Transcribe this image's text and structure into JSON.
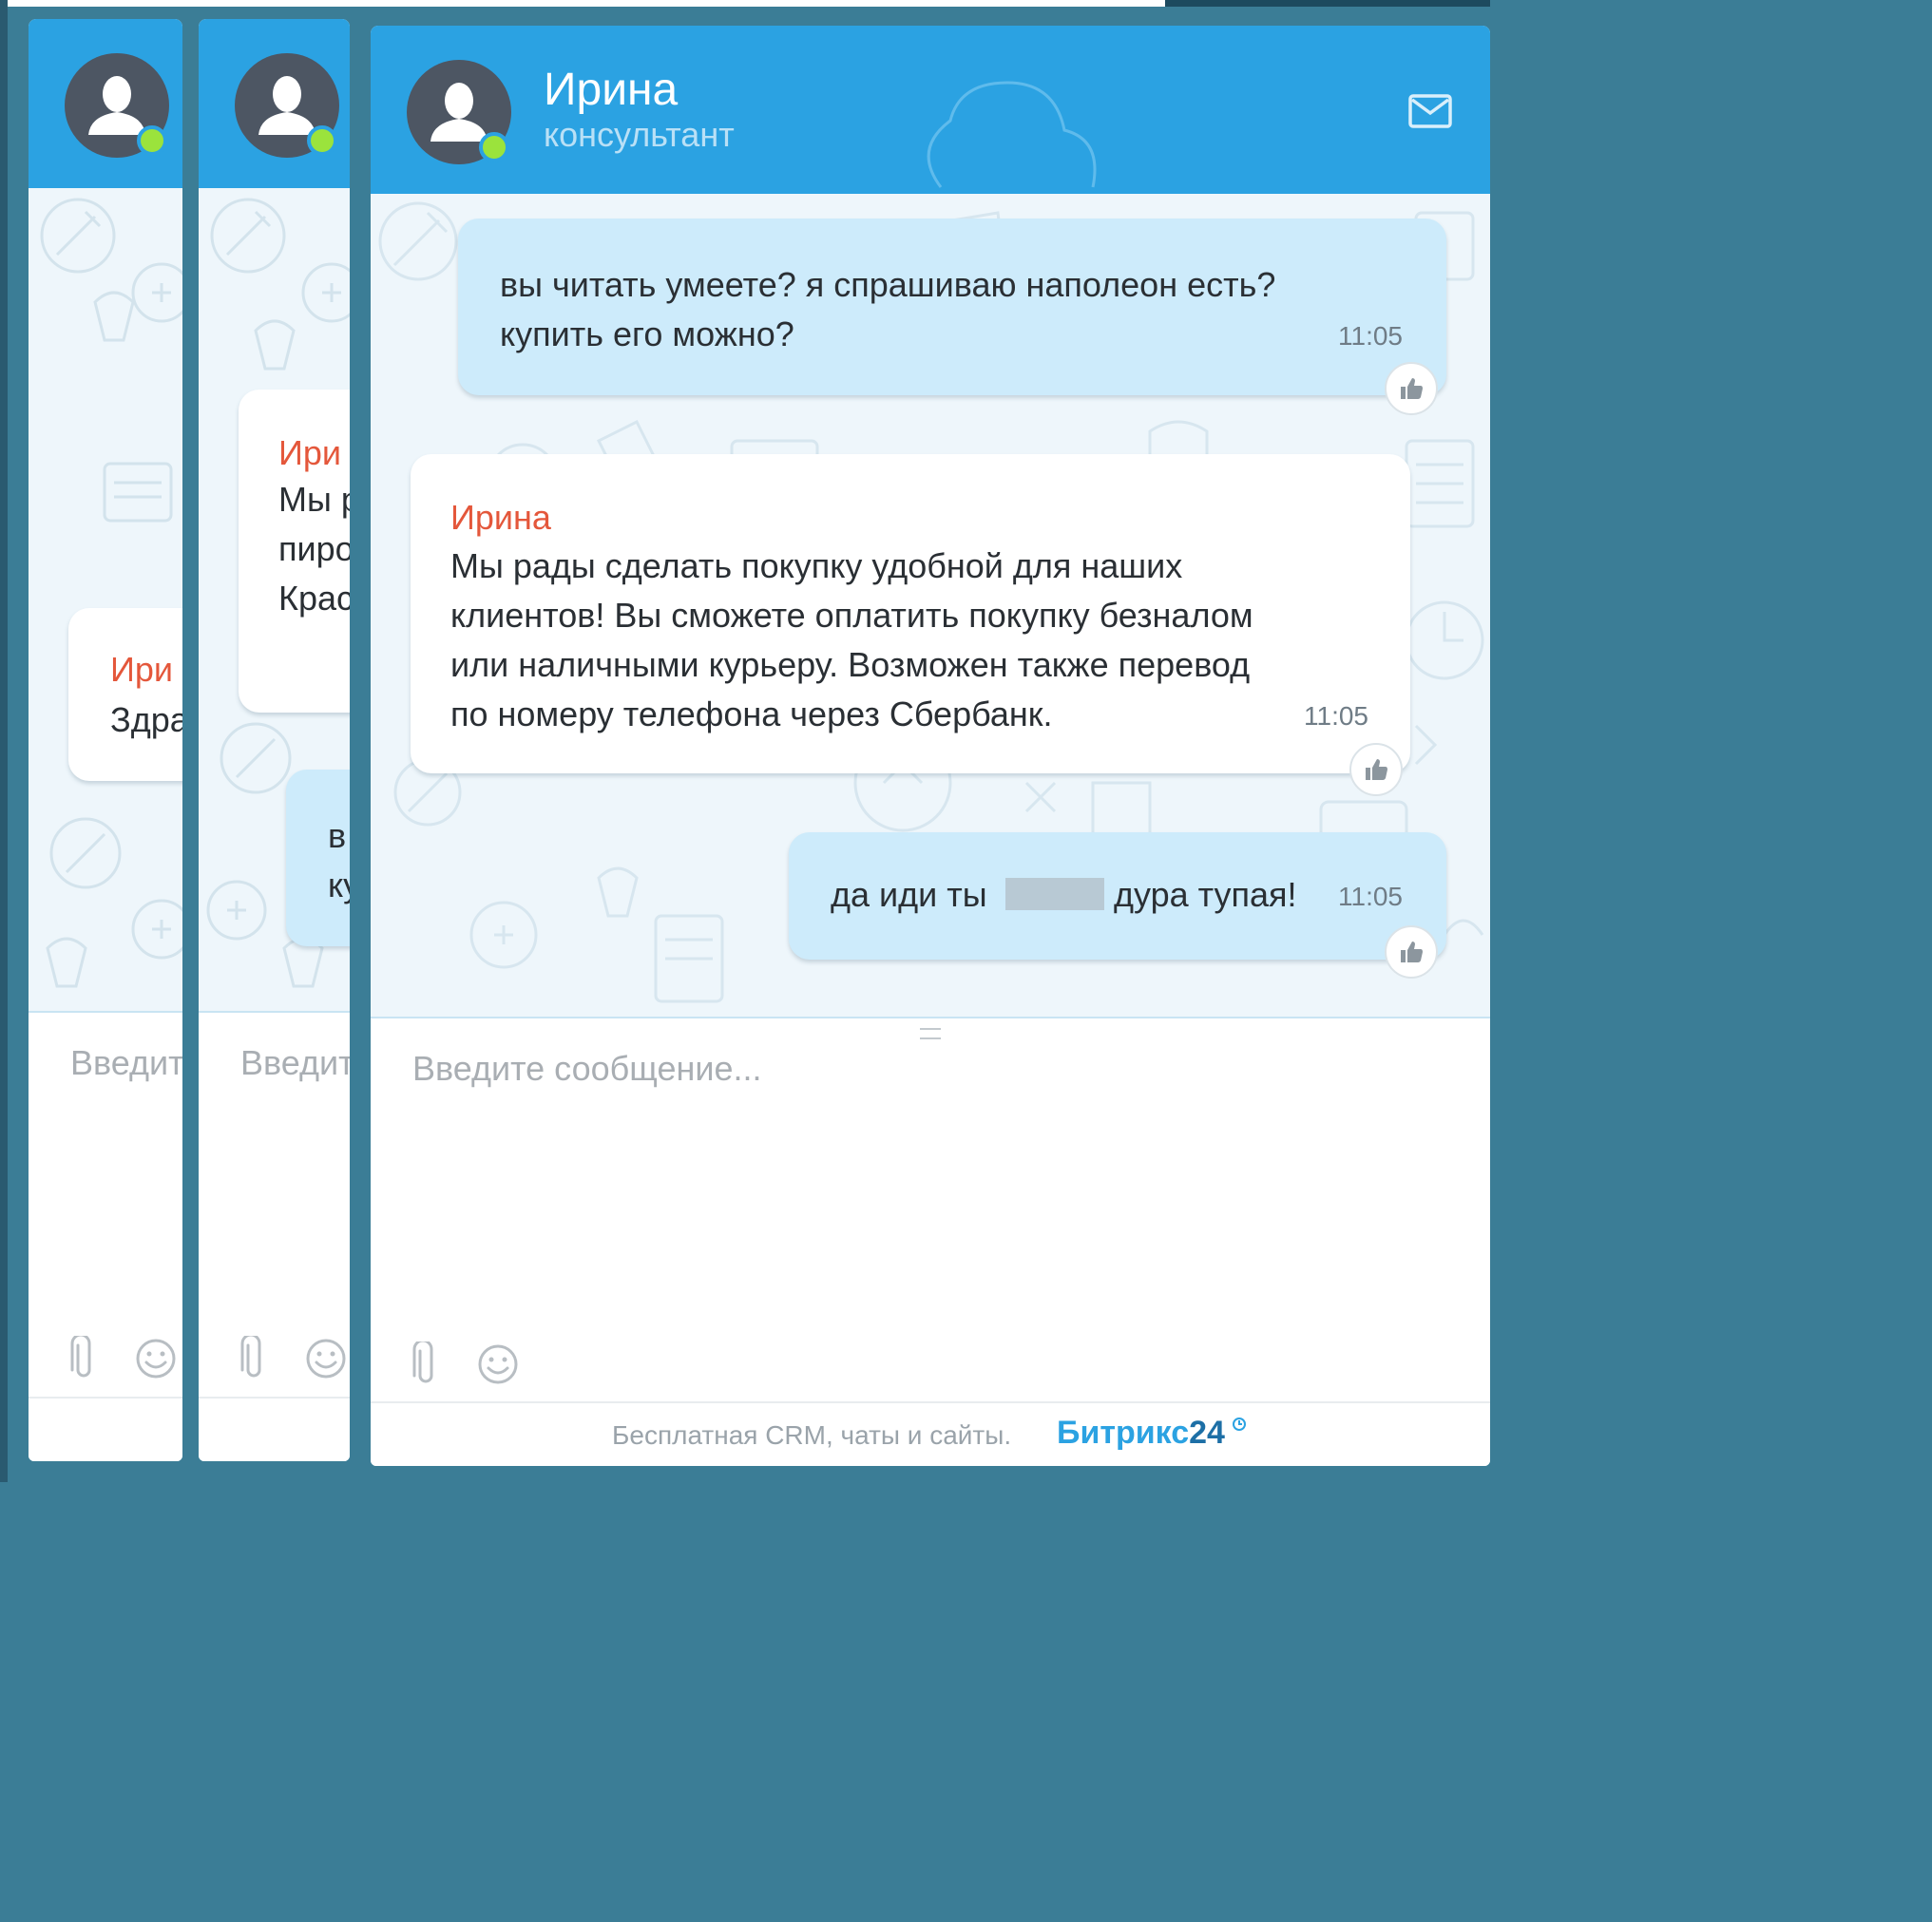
{
  "operator": {
    "name": "Ирина",
    "role": "консультант"
  },
  "colors": {
    "header": "#2ba2e2",
    "author": "#e4573b",
    "outgoing_bubble": "#cdebfb",
    "online": "#9be33c",
    "brand": "#2ba2e2"
  },
  "messages": [
    {
      "direction": "outgoing",
      "lines": [
        "вы читать умеете? я спрашиваю наполеон есть?",
        "купить его можно?"
      ],
      "time": "11:05"
    },
    {
      "direction": "incoming",
      "author": "Ирина",
      "lines": [
        "Мы рады сделать покупку удобной для наших",
        "клиентов! Вы сможете оплатить покупку безналом",
        "или наличными курьеру. Возможен также перевод",
        "по номеру телефона через Сбербанк."
      ],
      "time": "11:05"
    },
    {
      "direction": "outgoing",
      "text_before": "да иди ты",
      "text_after": "дура тупая!",
      "time": "11:05"
    }
  ],
  "background_windows": {
    "window1": {
      "author": "Ири",
      "text": "Здра",
      "placeholder": "Введит"
    },
    "window2": {
      "author": "Ири",
      "lines": [
        "Мы р",
        "пиро",
        "Крас"
      ],
      "out_lines": [
        "в",
        "ку"
      ],
      "placeholder": "Введит"
    }
  },
  "input": {
    "placeholder": "Введите сообщение..."
  },
  "footer": {
    "text": "Бесплатная CRM, чаты и сайты.",
    "brand_name": "Битрикс",
    "brand_number": "24"
  },
  "icons": {
    "header_right": "envelope-icon",
    "tools": [
      "paperclip-icon",
      "smiley-icon"
    ],
    "like": "thumbs-up-icon",
    "brand_mark": "clock-icon"
  }
}
